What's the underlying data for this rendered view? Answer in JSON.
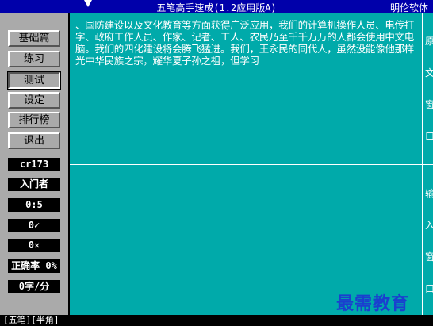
{
  "window": {
    "title": "五笔高手速成(1.2应用版A)",
    "company": "明伦软体"
  },
  "menu": [
    {
      "label": "基础篇"
    },
    {
      "label": "练习"
    },
    {
      "label": "测试"
    },
    {
      "label": "设定"
    },
    {
      "label": "排行榜"
    },
    {
      "label": "退出"
    }
  ],
  "stats": {
    "user": "cr173",
    "level": "入门者",
    "time": "0:5",
    "correct": "0✓",
    "wrong": "0✕",
    "accuracy": "正确率 0%",
    "speed": "0字/分"
  },
  "text": {
    "original": "、国防建设以及文化教育等方面获得广泛应用，我们的计算机操作人员、电传打字、政府工作人员、作家、记者、工人、农民乃至千千万万的人都会使用中文电脑。我们的四化建设将会腾飞猛进。我们，王永民的同代人，虽然没能像他那样光中华民族之宗，耀华夏子孙之祖，但学习",
    "orig_label": [
      "原",
      "文",
      "窗",
      "口"
    ],
    "input_label": [
      "输",
      "入",
      "窗",
      "口"
    ]
  },
  "watermark": "最需教育",
  "status": "[五笔][半角]",
  "colors": {
    "titlebar": "#0000aa",
    "panel": "#aaaaaa",
    "textarea": "#00aaaa",
    "watermark": "#1a3fcf"
  }
}
